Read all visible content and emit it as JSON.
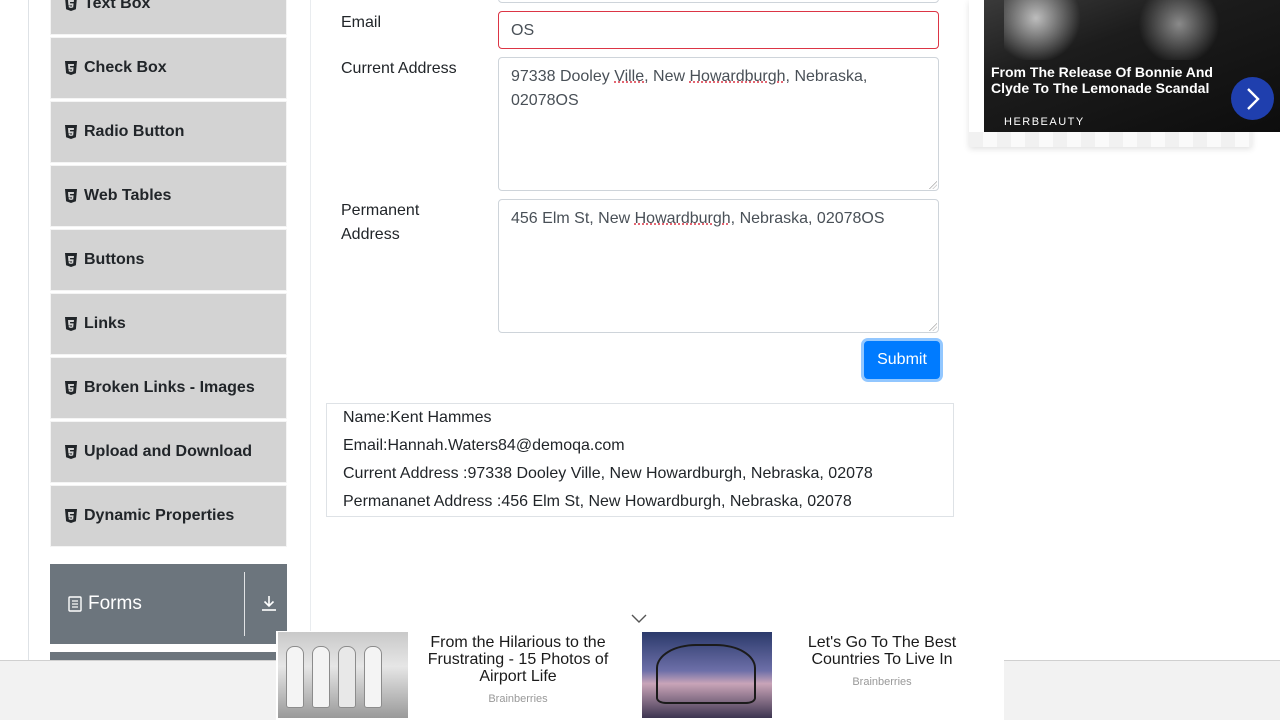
{
  "sidebar": {
    "items": [
      {
        "label": "Text Box"
      },
      {
        "label": "Check Box"
      },
      {
        "label": "Radio Button"
      },
      {
        "label": "Web Tables"
      },
      {
        "label": "Buttons"
      },
      {
        "label": "Links"
      },
      {
        "label": "Broken Links - Images"
      },
      {
        "label": "Upload and Download"
      },
      {
        "label": "Dynamic Properties"
      }
    ],
    "group": {
      "label": "Forms"
    }
  },
  "form": {
    "email": {
      "label": "Email",
      "value": "OS"
    },
    "current_address": {
      "label": "Current Address",
      "value_parts": [
        "97338 Dooley ",
        "Ville",
        ", New ",
        "Howardburgh",
        ", Nebraska,",
        "02078OS"
      ]
    },
    "permanent_address": {
      "label_line1": "Permanent",
      "label_line2": "Address",
      "value_parts": [
        "456 Elm St, New ",
        "Howardburgh",
        ", Nebraska, 02078OS"
      ]
    },
    "submit_label": "Submit"
  },
  "output": {
    "name": "Name:Kent Hammes",
    "email": "Email:Hannah.Waters84@demoqa.com",
    "current_address": "Current Address :97338 Dooley Ville, New Howardburgh, Nebraska, 02078",
    "permanent_address": "Permananet Address :456 Elm St, New Howardburgh, Nebraska, 02078"
  },
  "side_ad": {
    "title": "From The Release Of Bonnie And Clyde To The Lemonade Scandal",
    "brand": "HERBEAUTY"
  },
  "bottom_ad": {
    "left": {
      "title": "From the Hilarious to the Frustrating - 15 Photos of Airport Life",
      "source": "Brainberries"
    },
    "right": {
      "title": "Let's Go To The Best Countries To Live In",
      "source": "Brainberries"
    }
  },
  "colors": {
    "primary": "#007bff",
    "error": "#dc3545",
    "menu_bg": "#d3d3d3",
    "group_bg": "#6c757d"
  }
}
